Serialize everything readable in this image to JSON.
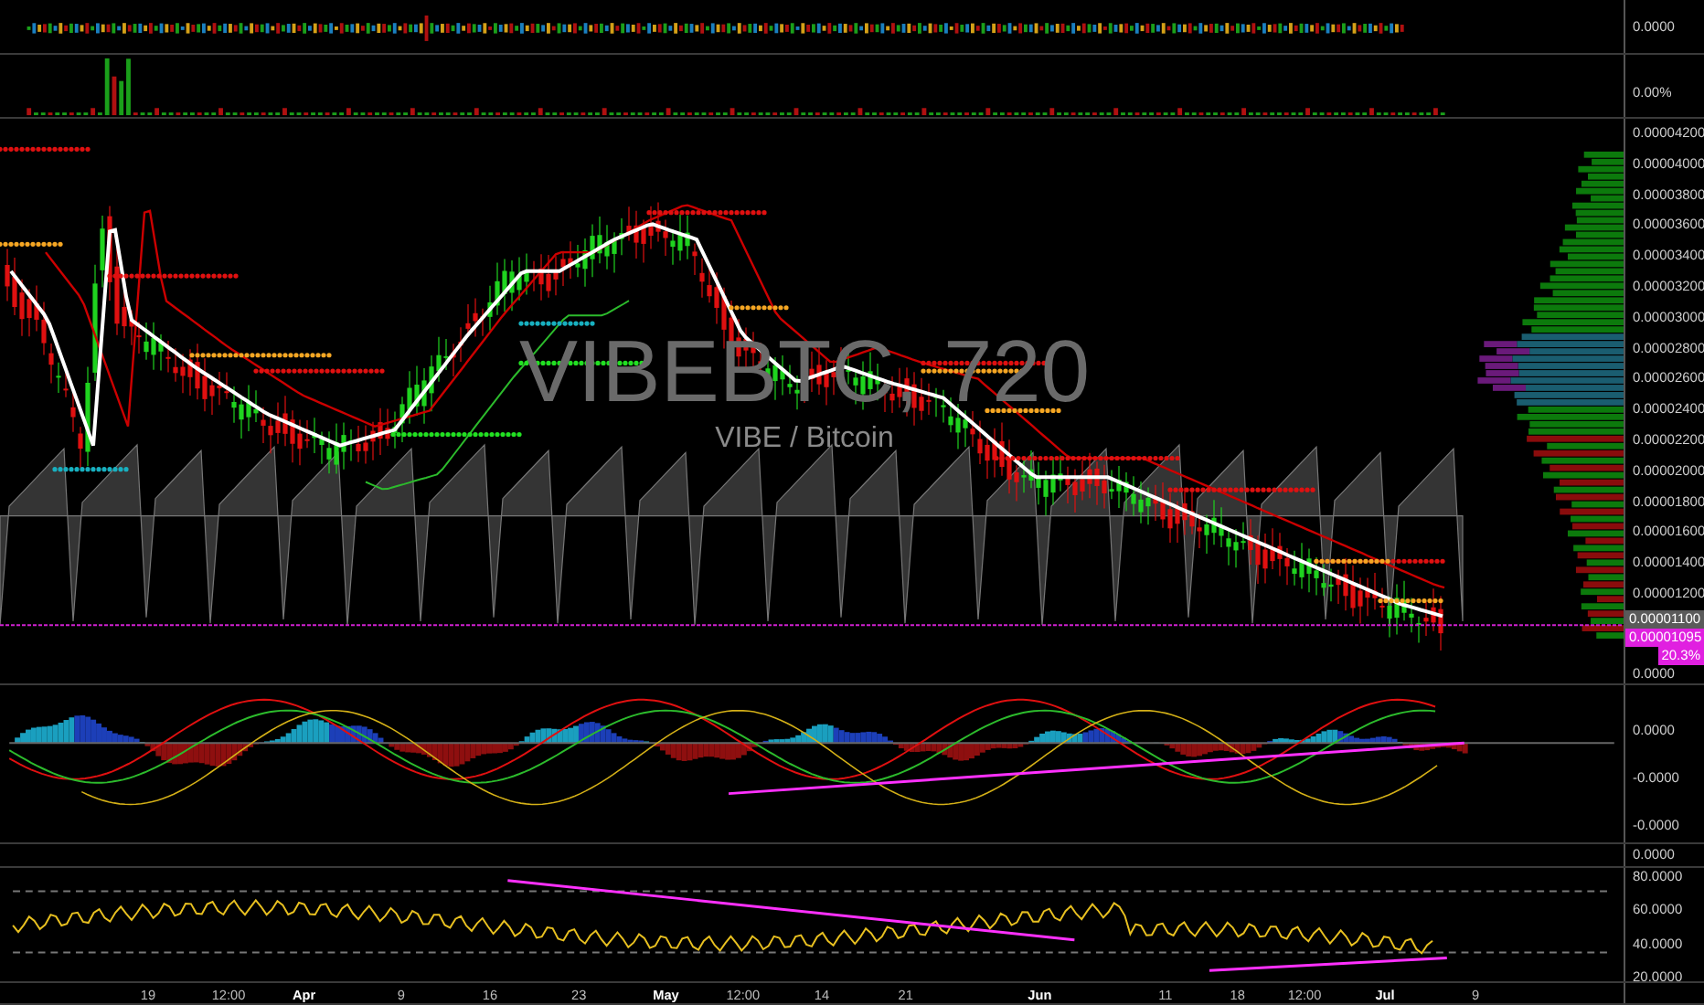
{
  "top_indicator": {
    "ticks": [
      "0.0000"
    ]
  },
  "volume_indicator": {
    "ticks": [
      "0.00%"
    ]
  },
  "price_chart": {
    "symbol": "VIBEBTC, 720",
    "description": "VIBE / Bitcoin",
    "ticks": [
      "0.00004200",
      "0.00004000",
      "0.00003800",
      "0.00003600",
      "0.00003400",
      "0.00003200",
      "0.00003000",
      "0.00002800",
      "0.00002600",
      "0.00002400",
      "0.00002200",
      "0.00002000",
      "0.00001800",
      "0.00001600",
      "0.00001400",
      "0.00001200"
    ],
    "current_price": "0.00001100",
    "last_price": "0.00001095",
    "change": "20.3%",
    "cut_tick": "0.0000"
  },
  "macd": {
    "ticks": [
      "0.0000",
      "-0.0000",
      "-0.0000"
    ]
  },
  "small_indicator": {
    "ticks": [
      "0.0000"
    ]
  },
  "rsi": {
    "ticks": [
      "80.0000",
      "60.0000",
      "40.0000",
      "20.0000"
    ]
  },
  "time_axis": [
    {
      "label": "19",
      "kind": "day"
    },
    {
      "label": "12:00",
      "kind": "time"
    },
    {
      "label": "Apr",
      "kind": "month"
    },
    {
      "label": "9",
      "kind": "day"
    },
    {
      "label": "16",
      "kind": "day"
    },
    {
      "label": "23",
      "kind": "day"
    },
    {
      "label": "May",
      "kind": "month"
    },
    {
      "label": "12:00",
      "kind": "time"
    },
    {
      "label": "14",
      "kind": "day"
    },
    {
      "label": "21",
      "kind": "day"
    },
    {
      "label": "Jun",
      "kind": "month"
    },
    {
      "label": "11",
      "kind": "day"
    },
    {
      "label": "18",
      "kind": "day"
    },
    {
      "label": "12:00",
      "kind": "time"
    },
    {
      "label": "Jul",
      "kind": "month"
    },
    {
      "label": "9",
      "kind": "day"
    }
  ]
}
